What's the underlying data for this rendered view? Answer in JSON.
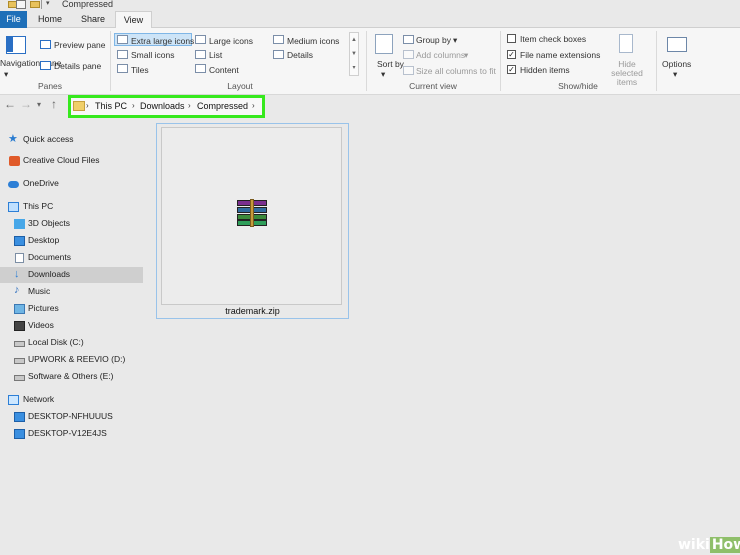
{
  "window": {
    "title": "Compressed"
  },
  "tabs": {
    "file": "File",
    "home": "Home",
    "share": "Share",
    "view": "View"
  },
  "ribbon": {
    "panes": {
      "navigation_pane": "Navigation pane",
      "preview_pane": "Preview pane",
      "details_pane": "Details pane",
      "group_label": "Panes"
    },
    "layout": {
      "extra_large_icons": "Extra large icons",
      "large_icons": "Large icons",
      "medium_icons": "Medium icons",
      "small_icons": "Small icons",
      "list": "List",
      "details": "Details",
      "tiles": "Tiles",
      "content": "Content",
      "group_label": "Layout",
      "selected": "Extra large icons"
    },
    "current_view": {
      "sort_by": "Sort by",
      "group_by": "Group by",
      "add_columns": "Add columns",
      "size_all_columns": "Size all columns to fit",
      "group_label": "Current view"
    },
    "show_hide": {
      "item_check_boxes": {
        "label": "Item check boxes",
        "checked": false
      },
      "file_name_extensions": {
        "label": "File name extensions",
        "checked": true
      },
      "hidden_items": {
        "label": "Hidden items",
        "checked": true
      },
      "hide_selected_items": "Hide selected items",
      "group_label": "Show/hide"
    },
    "options": "Options"
  },
  "address": {
    "parts": [
      "This PC",
      "Downloads",
      "Compressed"
    ]
  },
  "sidebar": {
    "items": [
      {
        "label": "Quick access",
        "icon": "star-icon"
      },
      {
        "label": "Creative Cloud Files",
        "icon": "creative-cloud-icon"
      },
      {
        "label": "OneDrive",
        "icon": "cloud-icon"
      },
      {
        "label": "This PC",
        "icon": "computer-icon"
      },
      {
        "label": "3D Objects",
        "icon": "cube-icon"
      },
      {
        "label": "Desktop",
        "icon": "desktop-icon"
      },
      {
        "label": "Documents",
        "icon": "document-icon"
      },
      {
        "label": "Downloads",
        "icon": "download-arrow-icon",
        "selected": true
      },
      {
        "label": "Music",
        "icon": "music-note-icon"
      },
      {
        "label": "Pictures",
        "icon": "picture-icon"
      },
      {
        "label": "Videos",
        "icon": "film-icon"
      },
      {
        "label": "Local Disk (C:)",
        "icon": "drive-icon"
      },
      {
        "label": "UPWORK & REEVIO (D:)",
        "icon": "drive-icon"
      },
      {
        "label": "Software & Others (E:)",
        "icon": "drive-icon"
      },
      {
        "label": "Network",
        "icon": "network-icon"
      },
      {
        "label": "DESKTOP-NFHUUUS",
        "icon": "monitor-icon"
      },
      {
        "label": "DESKTOP-V12E4JS",
        "icon": "monitor-icon"
      }
    ]
  },
  "files": [
    {
      "name": "trademark.zip",
      "icon": "winrar-archive-icon"
    }
  ],
  "watermark": {
    "part1": "wiki",
    "part2": "How"
  },
  "colors": {
    "file_tab": "#1e6fb8",
    "highlight_box": "#36e91d",
    "selection": "#cde4f7"
  }
}
